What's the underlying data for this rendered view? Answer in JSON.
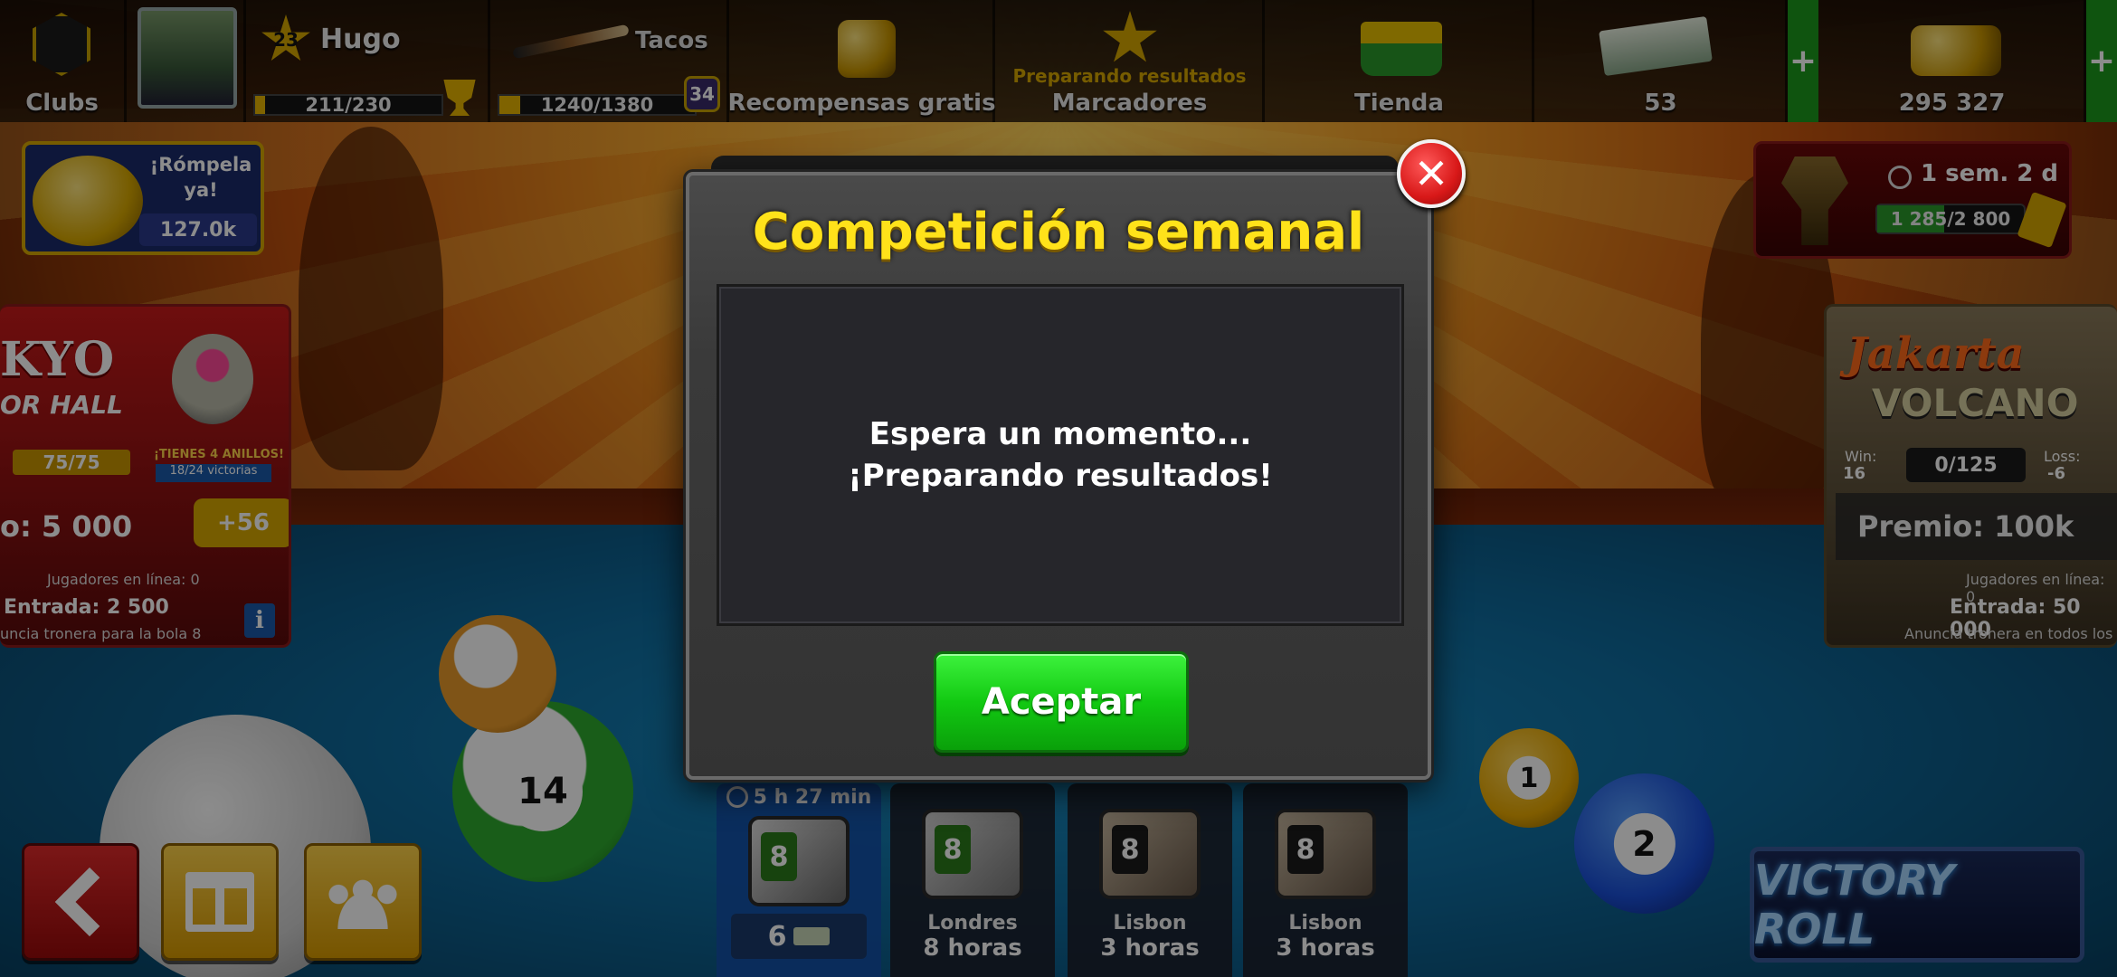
{
  "topbar": {
    "clubs_label": "Clubs",
    "player_name": "Hugo",
    "player_level": "23",
    "xp_progress": "211/230",
    "xp_fraction": 0.917,
    "cues_label": "Tacos",
    "cues_progress": "1240/1380",
    "cues_fraction": 0.899,
    "cues_level": "34",
    "free_rewards_label": "Recompensas gratis",
    "leaderboard_status": "Preparando resultados",
    "leaderboard_label": "Marcadores",
    "shop_label": "Tienda",
    "cash_amount": "53",
    "coins_amount": "295 327",
    "plus": "+"
  },
  "piggy": {
    "text": "¡Rómpela ya!",
    "amount": "127.0k"
  },
  "season": {
    "time_left": "1 sem. 2 d",
    "progress": "1 285/2 800",
    "fraction": 0.459
  },
  "tokyo": {
    "title_part": "KYO",
    "subtitle_part": "OR HALL",
    "trophies": "75/75",
    "rings_text": "¡TIENES 4 ANILLOS!",
    "wins_text": "18/24 victorias",
    "prize": "o: 5 000",
    "bonus": "+56",
    "online": "Jugadores en línea: 0",
    "entry": "Entrada: 2 500",
    "rule": "uncia tronera para la bola 8",
    "info": "i"
  },
  "jakarta": {
    "title": "Jakarta",
    "subtitle": "VOLCANO",
    "win_label": "Win:",
    "win_value": "16",
    "trophies": "0/125",
    "loss_label": "Loss:",
    "loss_value": "-6",
    "prize": "Premio: 100k",
    "online": "Jugadores en línea: 0",
    "entry": "Entrada: 50 000",
    "rule": "Anuncia tronera en todos los"
  },
  "dialog": {
    "title": "Competición semanal",
    "message_line1": "Espera un momento...",
    "message_line2": "¡Preparando resultados!",
    "accept_label": "Aceptar",
    "close_symbol": "✕"
  },
  "boxes": [
    {
      "timer": "5 h 27 min",
      "count": "6"
    },
    {
      "city": "Londres",
      "time": "8 horas"
    },
    {
      "city": "Lisbon",
      "time": "3 horas"
    },
    {
      "city": "Lisbon",
      "time": "3 horas"
    }
  ],
  "victory_roll": {
    "label": "VICTORY ROLL"
  },
  "balls": {
    "n14": "14",
    "n1": "1",
    "n2": "2"
  },
  "colors": {
    "dialog_title": "#ffe21a",
    "accept_green": "#12c912",
    "close_red": "#d81818",
    "table_blue": "#0e6a9c"
  },
  "icons": [
    "clubs-emblem-icon",
    "avatar",
    "level-star-icon",
    "trophy-icon",
    "cue-icon",
    "free-coins-icon",
    "leaderboard-star-icon",
    "shop-basket-icon",
    "cash-icon",
    "coins-icon",
    "piggy-bank-icon",
    "clock-icon",
    "back-arrow-icon",
    "gift-icon",
    "friends-icon"
  ]
}
